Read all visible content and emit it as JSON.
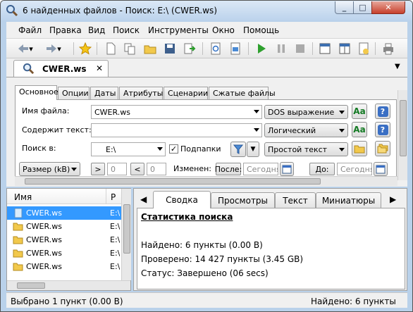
{
  "window": {
    "title": "6 найденных файлов - Поиск: E:\\ (CWER.ws)"
  },
  "menu": [
    "Файл",
    "Правка",
    "Вид",
    "Поиск",
    "Инструменты",
    "Окно",
    "Помощь"
  ],
  "doc_tab": {
    "label": "CWER.ws"
  },
  "search_tabs": [
    "Основное",
    "Опции",
    "Даты",
    "Атрибуты",
    "Сценарии",
    "Сжатые файлы"
  ],
  "form": {
    "filename_label": "Имя файла:",
    "filename_value": "CWER.ws",
    "filename_mode": "DOS выражение",
    "contains_label": "Содержит текст:",
    "contains_value": "",
    "contains_mode": "Логический",
    "searchin_label": "Поиск в:",
    "searchin_value": "E:\\",
    "subfolders_label": "Подпапки",
    "searchin_mode": "Простой текст",
    "aa_label": "Aa",
    "help_label": "?",
    "size_select": "Размер (kB)",
    "gt": ">",
    "lt": "<",
    "size_min": "0",
    "size_max": "0",
    "changed_label": "Изменен:",
    "after_btn": "После:",
    "after_date": "Сегодня",
    "before_btn": "До:",
    "before_date": "Сегодня"
  },
  "files": {
    "col_name": "Имя",
    "col_path": "Р",
    "rows": [
      {
        "name": "CWER.ws",
        "path": "E:\\",
        "selected": true
      },
      {
        "name": "CWER.ws",
        "path": "E:\\",
        "selected": false
      },
      {
        "name": "CWER.ws",
        "path": "E:\\",
        "selected": false
      },
      {
        "name": "CWER.ws",
        "path": "E:\\",
        "selected": false
      },
      {
        "name": "CWER.ws",
        "path": "E:\\",
        "selected": false
      }
    ]
  },
  "result_tabs": [
    "Сводка",
    "Просмотры",
    "Текст",
    "Миниатюры"
  ],
  "summary": {
    "heading": "Статистика поиска",
    "found": "Найдено: 6 пункты (0.00 B)",
    "checked": "Проверено: 14 427 пункты (3.45 GB)",
    "status": "Статус: Завершено (06 secs)"
  },
  "statusbar": {
    "left": "Выбрано 1 пункт (0.00 B)",
    "right": "Найдено: 6 пункты"
  },
  "colors": {
    "selection": "#3399ff",
    "frame": "#b9d1ea",
    "close": "#c7402c"
  }
}
